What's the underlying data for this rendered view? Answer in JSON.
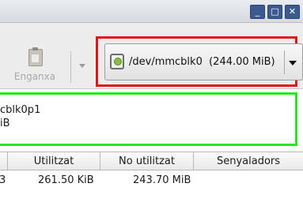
{
  "window": {
    "minimize_glyph": "_",
    "maximize_glyph": "□",
    "close_glyph": "✕"
  },
  "toolbar": {
    "paste_label": "Enganxa",
    "paste_icon": "paste-icon"
  },
  "device_selector": {
    "value": "/dev/mmcblk0  (244.00 MiB)",
    "icon": "disk-icon",
    "highlight_color": "#e01414"
  },
  "partition_graphic": {
    "name": "cblk0p1",
    "size": "iB",
    "highlight_color": "#26e61f"
  },
  "table": {
    "columns": [
      "",
      "Utilitzat",
      "No utilitzat",
      "Senyaladors"
    ],
    "rows": [
      [
        "3",
        "261.50 KiB",
        "243.70 MiB",
        ""
      ]
    ]
  }
}
